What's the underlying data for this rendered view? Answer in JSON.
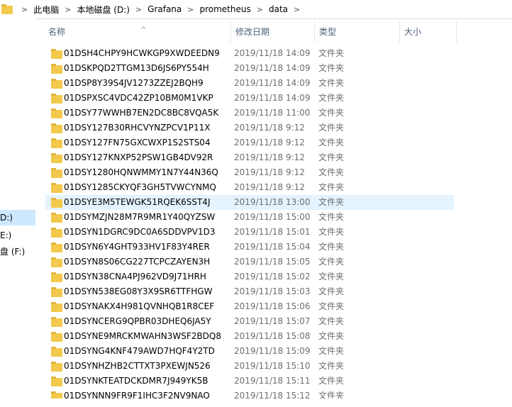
{
  "breadcrumb": [
    "此电脑",
    "本地磁盘 (D:)",
    "Grafana",
    "prometheus",
    "data"
  ],
  "columns": {
    "name": "名称",
    "modified": "修改日期",
    "type": "类型",
    "size": "大小"
  },
  "left_pane": [
    {
      "label": "D:)",
      "selected": true
    },
    {
      "label": "E:)",
      "selected": false
    },
    {
      "label": "盘 (F:)",
      "selected": false
    }
  ],
  "files": [
    {
      "name": "01DSH4CHPY9HCWKGP9XWDEEDN9",
      "date": "2019/11/18 14:09",
      "type": "文件夹"
    },
    {
      "name": "01DSKPQD2TTGM13D6JS6PY554H",
      "date": "2019/11/18 14:09",
      "type": "文件夹"
    },
    {
      "name": "01DSP8Y39S4JV1273ZZEJ2BQH9",
      "date": "2019/11/18 14:09",
      "type": "文件夹"
    },
    {
      "name": "01DSPXSC4VDC42ZP10BM0M1VKP",
      "date": "2019/11/18 14:09",
      "type": "文件夹"
    },
    {
      "name": "01DSY77WWHB7EN2DC8BC8VQA5K",
      "date": "2019/11/18 11:00",
      "type": "文件夹"
    },
    {
      "name": "01DSY127B30RHCVYNZPCV1P11X",
      "date": "2019/11/18 9:12",
      "type": "文件夹"
    },
    {
      "name": "01DSY127FN75GXCWXP1S2STS04",
      "date": "2019/11/18 9:12",
      "type": "文件夹"
    },
    {
      "name": "01DSY127KNXP52PSW1GB4DV92R",
      "date": "2019/11/18 9:12",
      "type": "文件夹"
    },
    {
      "name": "01DSY1280HQNWMMY1N7Y44N36Q",
      "date": "2019/11/18 9:12",
      "type": "文件夹"
    },
    {
      "name": "01DSY1285CKYQF3GH5TVWCYNMQ",
      "date": "2019/11/18 9:12",
      "type": "文件夹"
    },
    {
      "name": "01DSYE3M5TEWGK51RQEK6SST4J",
      "date": "2019/11/18 13:00",
      "type": "文件夹",
      "selected": true
    },
    {
      "name": "01DSYMZJN28M7R9MR1Y40QYZSW",
      "date": "2019/11/18 15:00",
      "type": "文件夹"
    },
    {
      "name": "01DSYN1DGRC9DC0A6SDDVPV1D3",
      "date": "2019/11/18 15:01",
      "type": "文件夹"
    },
    {
      "name": "01DSYN6Y4GHT933HV1F83Y4RER",
      "date": "2019/11/18 15:04",
      "type": "文件夹"
    },
    {
      "name": "01DSYN8S06CG227TCPCZAYEN3H",
      "date": "2019/11/18 15:05",
      "type": "文件夹"
    },
    {
      "name": "01DSYN38CNA4PJ962VD9J71HRH",
      "date": "2019/11/18 15:02",
      "type": "文件夹"
    },
    {
      "name": "01DSYN538EG08Y3X9SR6TTFHGW",
      "date": "2019/11/18 15:03",
      "type": "文件夹"
    },
    {
      "name": "01DSYNAKX4H981QVNHQB1R8CEF",
      "date": "2019/11/18 15:06",
      "type": "文件夹"
    },
    {
      "name": "01DSYNCERG9QPBR03DHEQ6JA5Y",
      "date": "2019/11/18 15:07",
      "type": "文件夹"
    },
    {
      "name": "01DSYNE9MRCKMWAHN3WSF2BDQ8",
      "date": "2019/11/18 15:08",
      "type": "文件夹"
    },
    {
      "name": "01DSYNG4KNF479AWD7HQF4Y2TD",
      "date": "2019/11/18 15:09",
      "type": "文件夹"
    },
    {
      "name": "01DSYNHZHB2CTTXT3PXEWJN526",
      "date": "2019/11/18 15:10",
      "type": "文件夹"
    },
    {
      "name": "01DSYNKTEATDCKDMR7J949YK5B",
      "date": "2019/11/18 15:11",
      "type": "文件夹"
    },
    {
      "name": "01DSYNNN9FR9F1JHC3F2NV9NAQ",
      "date": "2019/11/18 15:12",
      "type": "文件夹"
    }
  ],
  "colors": {
    "selection": "#e5f3ff",
    "header_text": "#4c607a",
    "folder": "#f2c94c"
  }
}
